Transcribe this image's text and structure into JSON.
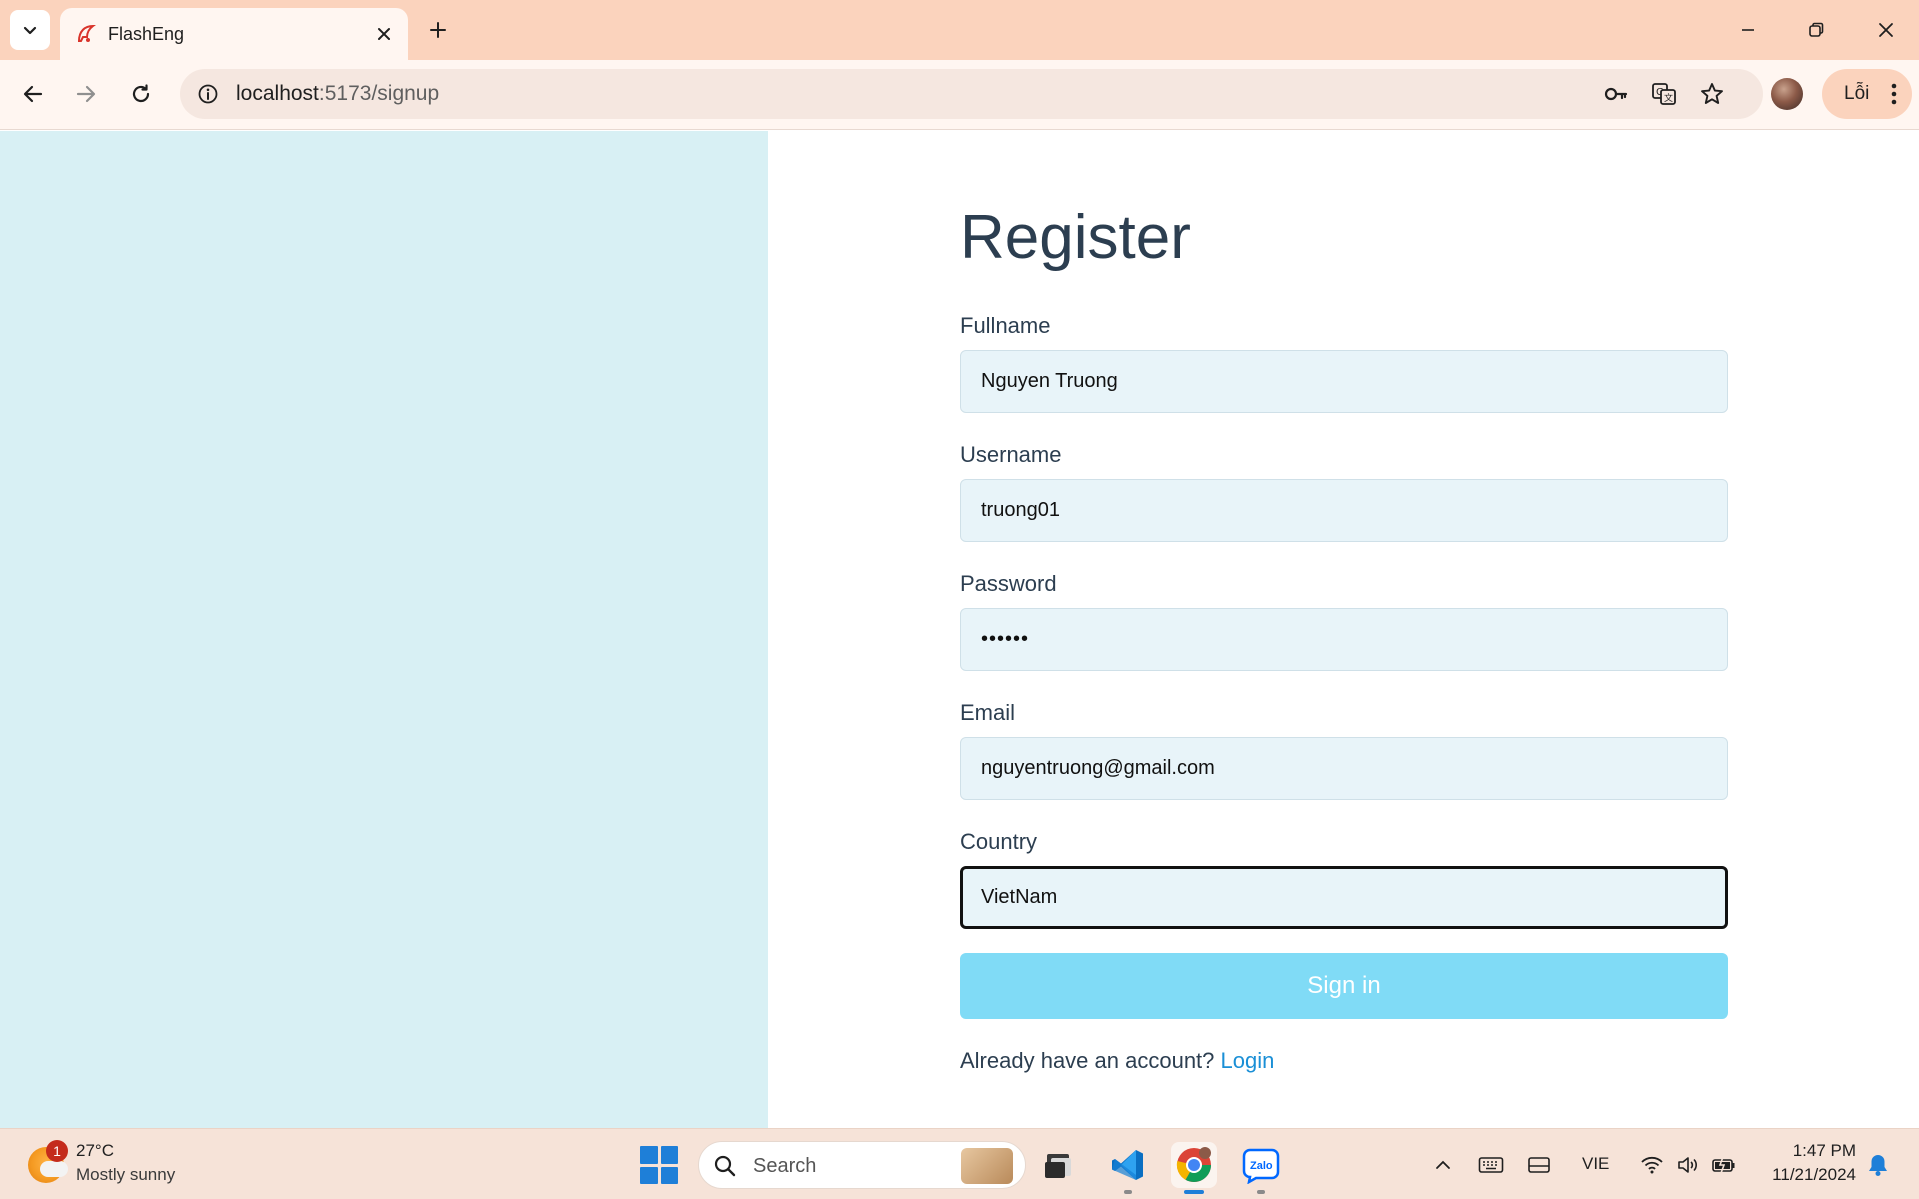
{
  "browser": {
    "tab": {
      "title": "FlashEng"
    },
    "address_bar": {
      "host": "localhost",
      "path": ":5173/signup"
    },
    "profile": {
      "label": "Lỗi"
    }
  },
  "form": {
    "title": "Register",
    "fields": [
      {
        "label": "Fullname",
        "value": "Nguyen Truong"
      },
      {
        "label": "Username",
        "value": "truong01"
      },
      {
        "label": "Password",
        "value": "••••••"
      },
      {
        "label": "Email",
        "value": "nguyentruong@gmail.com"
      },
      {
        "label": "Country",
        "value": "VietNam"
      }
    ],
    "submit_label": "Sign in",
    "account_prompt": "Already have an account?",
    "login_link": "Login"
  },
  "colors": {
    "side_panel": "#d8f0f4",
    "input_bg": "#e8f4f9",
    "submit_bg": "#80dbf6",
    "link": "#1a8fd6",
    "heading": "#2c3e50"
  },
  "taskbar": {
    "weather": {
      "temp": "27°C",
      "desc": "Mostly sunny",
      "badge": "1"
    },
    "search_label": "Search",
    "apps": [
      "file-explorer-icon",
      "vscode-icon",
      "chrome-icon",
      "zalo-icon"
    ],
    "language": "VIE",
    "time": "1:47 PM",
    "date": "11/21/2024"
  }
}
